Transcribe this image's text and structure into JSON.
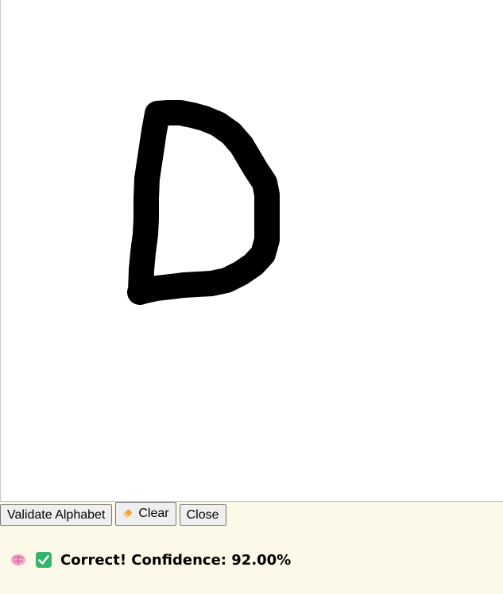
{
  "toolbar": {
    "validate_label": "Validate Alphabet",
    "clear_label": "Clear",
    "close_label": "Close"
  },
  "status": {
    "message": "Correct! Confidence: 92.00%",
    "icons": [
      "brain-icon",
      "check-icon"
    ]
  },
  "drawing": {
    "stroke_color": "#000000"
  },
  "colors": {
    "panel_background": "#fdf9e8",
    "check_green": "#34b36b",
    "brain_pink": "#f4a6c8",
    "eraser_orange": "#f5a03c"
  }
}
